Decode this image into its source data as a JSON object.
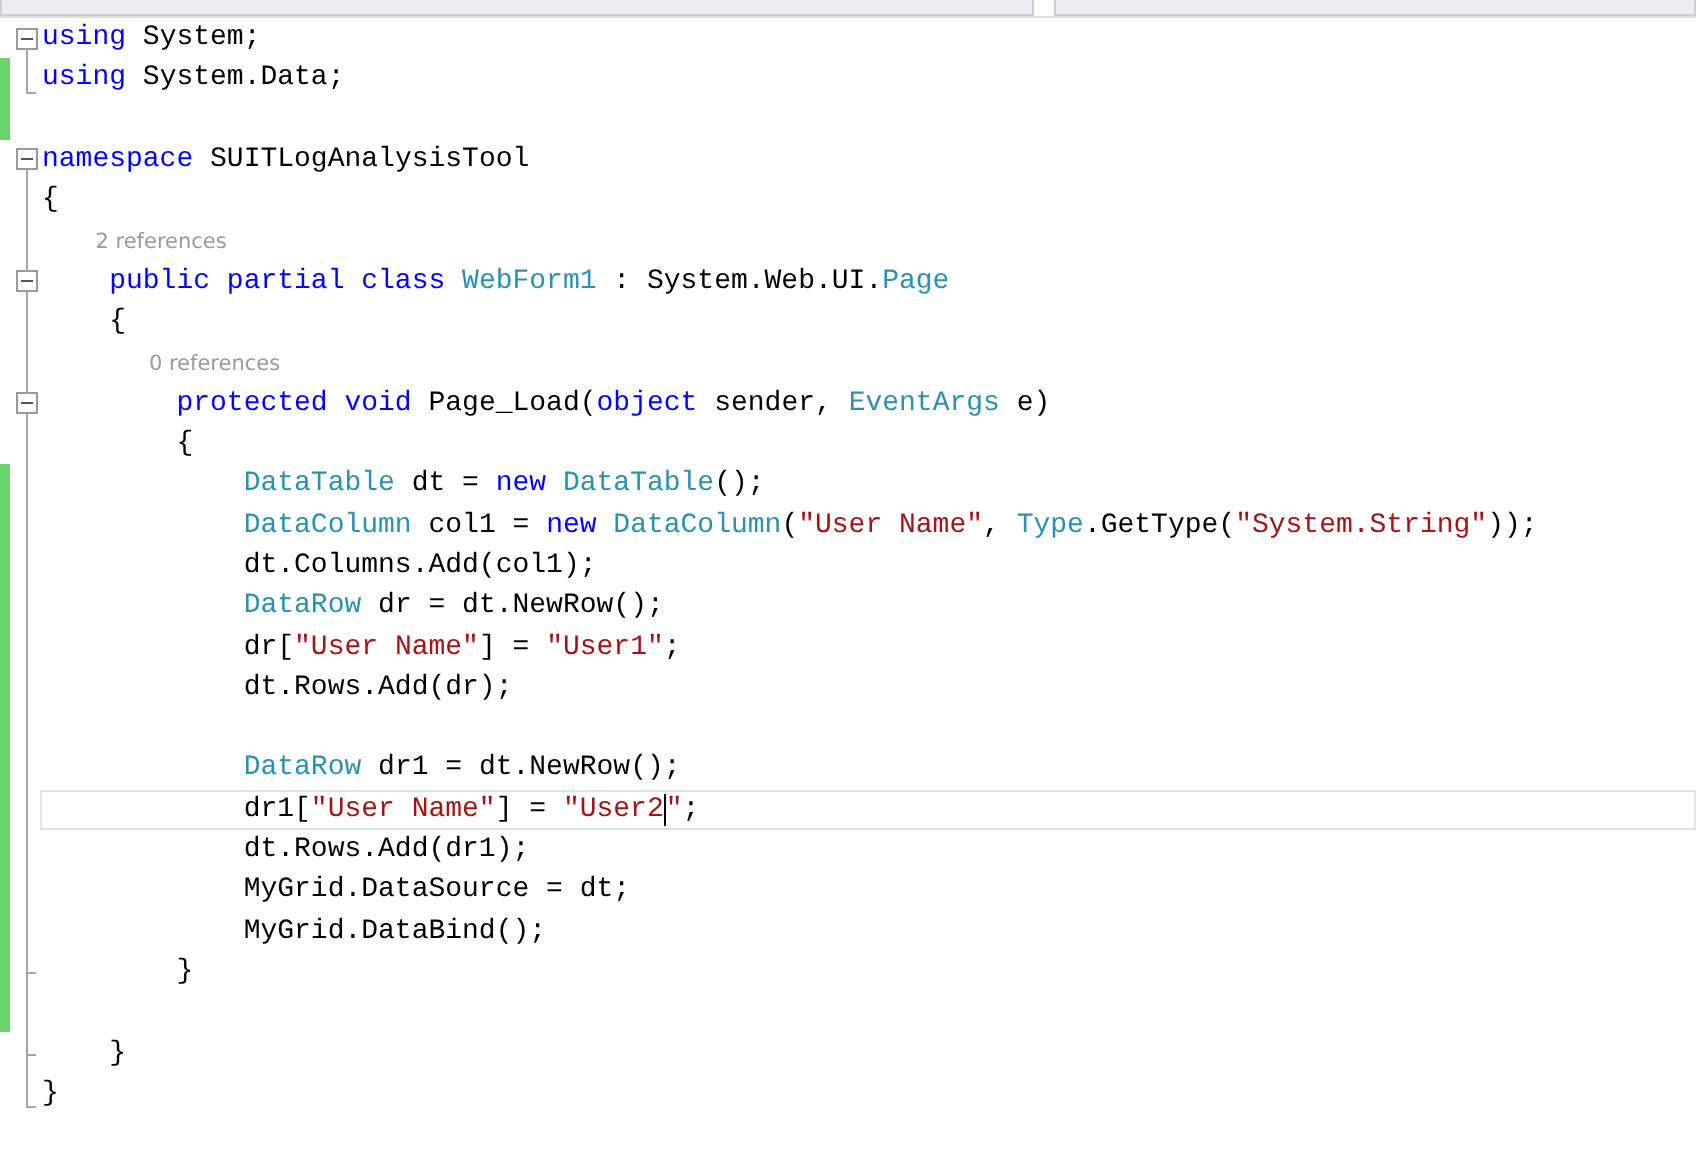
{
  "lines": [
    {
      "kind": "code",
      "changed": false,
      "foldable": true,
      "region_end": false,
      "current": false,
      "tokens": [
        {
          "kind": "keyword",
          "s": "using"
        },
        {
          "kind": "plain",
          "s": " System;"
        }
      ]
    },
    {
      "kind": "code",
      "changed": true,
      "foldable": false,
      "region_end": true,
      "current": false,
      "tokens": [
        {
          "kind": "keyword",
          "s": "using"
        },
        {
          "kind": "plain",
          "s": " System.Data;"
        }
      ]
    },
    {
      "kind": "blank",
      "changed": true,
      "foldable": false,
      "region_end": false,
      "current": false
    },
    {
      "kind": "code",
      "changed": false,
      "foldable": true,
      "region_end": false,
      "current": false,
      "tokens": [
        {
          "kind": "keyword",
          "s": "namespace"
        },
        {
          "kind": "plain",
          "s": " SUITLogAnalysisTool"
        }
      ]
    },
    {
      "kind": "code",
      "changed": false,
      "foldable": false,
      "region_end": false,
      "current": false,
      "tokens": [
        {
          "kind": "plain",
          "s": "{"
        }
      ]
    },
    {
      "kind": "codelens",
      "changed": false,
      "foldable": false,
      "region_end": false,
      "current": false,
      "text": "2 references"
    },
    {
      "kind": "code",
      "changed": false,
      "foldable": true,
      "region_end": false,
      "current": false,
      "tokens": [
        {
          "kind": "keyword",
          "s": "    public partial class "
        },
        {
          "kind": "type",
          "s": "WebForm1"
        },
        {
          "kind": "plain",
          "s": " : System.Web.UI."
        },
        {
          "kind": "type",
          "s": "Page"
        }
      ]
    },
    {
      "kind": "code",
      "changed": false,
      "foldable": false,
      "region_end": false,
      "current": false,
      "tokens": [
        {
          "kind": "plain",
          "s": "    {"
        }
      ]
    },
    {
      "kind": "codelens",
      "changed": false,
      "foldable": false,
      "region_end": false,
      "current": false,
      "text": "0 references"
    },
    {
      "kind": "code",
      "changed": false,
      "foldable": true,
      "region_end": false,
      "current": false,
      "tokens": [
        {
          "kind": "keyword",
          "s": "        protected void"
        },
        {
          "kind": "plain",
          "s": " Page_Load("
        },
        {
          "kind": "keyword",
          "s": "object"
        },
        {
          "kind": "plain",
          "s": " sender, "
        },
        {
          "kind": "type",
          "s": "EventArgs"
        },
        {
          "kind": "plain",
          "s": " e)"
        }
      ]
    },
    {
      "kind": "code",
      "changed": false,
      "foldable": false,
      "region_end": false,
      "current": false,
      "tokens": [
        {
          "kind": "plain",
          "s": "        {"
        }
      ]
    },
    {
      "kind": "code",
      "changed": true,
      "foldable": false,
      "region_end": false,
      "current": false,
      "tokens": [
        {
          "kind": "type",
          "s": "            DataTable"
        },
        {
          "kind": "plain",
          "s": " dt = "
        },
        {
          "kind": "keyword",
          "s": "new "
        },
        {
          "kind": "type",
          "s": "DataTable"
        },
        {
          "kind": "plain",
          "s": "();"
        }
      ]
    },
    {
      "kind": "code",
      "changed": true,
      "foldable": false,
      "region_end": false,
      "current": false,
      "tokens": [
        {
          "kind": "type",
          "s": "            DataColumn"
        },
        {
          "kind": "plain",
          "s": " col1 = "
        },
        {
          "kind": "keyword",
          "s": "new "
        },
        {
          "kind": "type",
          "s": "DataColumn"
        },
        {
          "kind": "plain",
          "s": "("
        },
        {
          "kind": "string",
          "s": "\"User Name\""
        },
        {
          "kind": "plain",
          "s": ", "
        },
        {
          "kind": "type",
          "s": "Type"
        },
        {
          "kind": "plain",
          "s": ".GetType("
        },
        {
          "kind": "string",
          "s": "\"System.String\""
        },
        {
          "kind": "plain",
          "s": "));"
        }
      ]
    },
    {
      "kind": "code",
      "changed": true,
      "foldable": false,
      "region_end": false,
      "current": false,
      "tokens": [
        {
          "kind": "plain",
          "s": "            dt.Columns.Add(col1);"
        }
      ]
    },
    {
      "kind": "code",
      "changed": true,
      "foldable": false,
      "region_end": false,
      "current": false,
      "tokens": [
        {
          "kind": "type",
          "s": "            DataRow"
        },
        {
          "kind": "plain",
          "s": " dr = dt.NewRow();"
        }
      ]
    },
    {
      "kind": "code",
      "changed": true,
      "foldable": false,
      "region_end": false,
      "current": false,
      "tokens": [
        {
          "kind": "plain",
          "s": "            dr["
        },
        {
          "kind": "string",
          "s": "\"User Name\""
        },
        {
          "kind": "plain",
          "s": "] = "
        },
        {
          "kind": "string",
          "s": "\"User1\""
        },
        {
          "kind": "plain",
          "s": ";"
        }
      ]
    },
    {
      "kind": "code",
      "changed": true,
      "foldable": false,
      "region_end": false,
      "current": false,
      "tokens": [
        {
          "kind": "plain",
          "s": "            dt.Rows.Add(dr);"
        }
      ]
    },
    {
      "kind": "blank",
      "changed": true,
      "foldable": false,
      "region_end": false,
      "current": false
    },
    {
      "kind": "code",
      "changed": true,
      "foldable": false,
      "region_end": false,
      "current": false,
      "tokens": [
        {
          "kind": "type",
          "s": "            DataRow"
        },
        {
          "kind": "plain",
          "s": " dr1 = dt.NewRow();"
        }
      ]
    },
    {
      "kind": "code",
      "changed": true,
      "foldable": false,
      "region_end": false,
      "current": true,
      "tokens": [
        {
          "kind": "plain",
          "s": "            dr1["
        },
        {
          "kind": "string",
          "s": "\"User Name\""
        },
        {
          "kind": "plain",
          "s": "] = "
        },
        {
          "kind": "string",
          "s": "\"User2",
          "caret_after": true
        },
        {
          "kind": "string",
          "s": "\""
        },
        {
          "kind": "plain",
          "s": ";"
        }
      ]
    },
    {
      "kind": "code",
      "changed": true,
      "foldable": false,
      "region_end": false,
      "current": false,
      "tokens": [
        {
          "kind": "plain",
          "s": "            dt.Rows.Add(dr1);"
        }
      ]
    },
    {
      "kind": "code",
      "changed": true,
      "foldable": false,
      "region_end": false,
      "current": false,
      "tokens": [
        {
          "kind": "plain",
          "s": "            MyGrid.DataSource = dt;"
        }
      ]
    },
    {
      "kind": "code",
      "changed": true,
      "foldable": false,
      "region_end": false,
      "current": false,
      "tokens": [
        {
          "kind": "plain",
          "s": "            MyGrid.DataBind();"
        }
      ]
    },
    {
      "kind": "code",
      "changed": true,
      "foldable": false,
      "region_end": true,
      "current": false,
      "tokens": [
        {
          "kind": "plain",
          "s": "        }"
        }
      ]
    },
    {
      "kind": "blank",
      "changed": true,
      "foldable": false,
      "region_end": false,
      "current": false
    },
    {
      "kind": "code",
      "changed": false,
      "foldable": false,
      "region_end": true,
      "current": false,
      "tokens": [
        {
          "kind": "plain",
          "s": "    }"
        }
      ]
    },
    {
      "kind": "code",
      "changed": false,
      "foldable": false,
      "region_end": true,
      "current": false,
      "tokens": [
        {
          "kind": "plain",
          "s": "}"
        }
      ]
    }
  ]
}
